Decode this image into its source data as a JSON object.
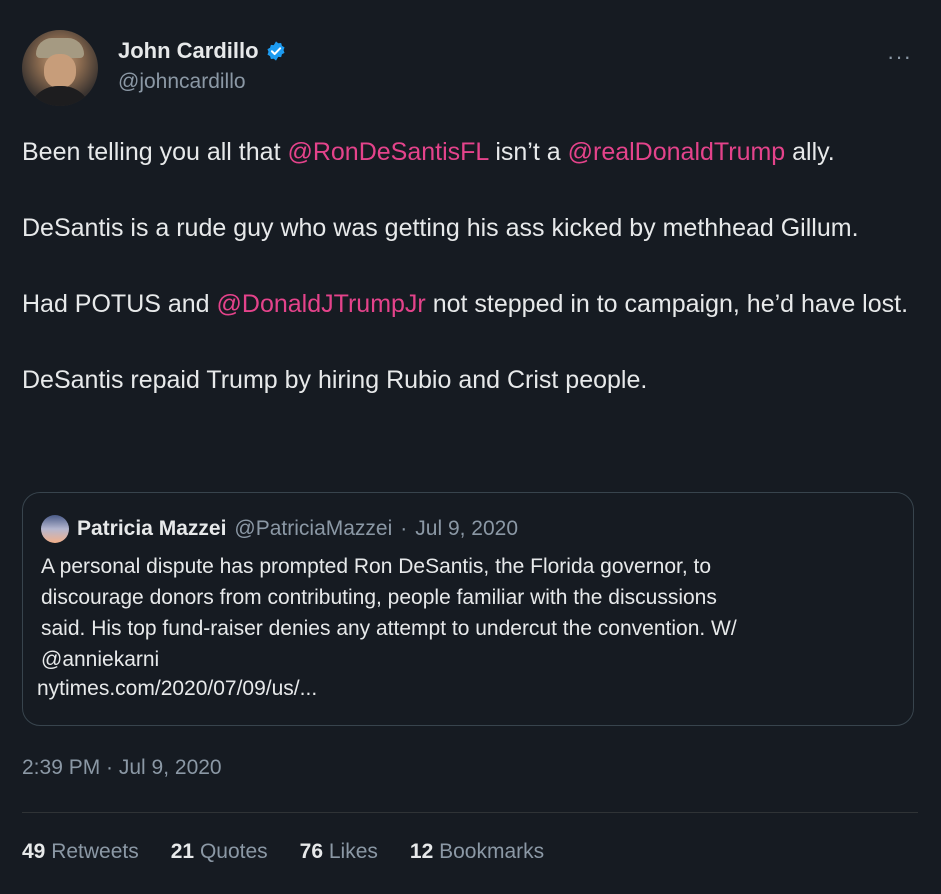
{
  "author": {
    "display_name": "John Cardillo",
    "handle": "@johncardillo",
    "verified_icon": "verified-badge-icon",
    "verified_color": "#1d9bf0"
  },
  "more_menu": "···",
  "tweet": {
    "paragraphs": [
      {
        "segments": [
          {
            "text": "Been telling you all that ",
            "mention": false
          },
          {
            "text": "@RonDeSantisFL",
            "mention": true
          },
          {
            "text": " isn’t a ",
            "mention": false
          },
          {
            "text": "@realDonaldTrump",
            "mention": true
          },
          {
            "text": " ally.",
            "mention": false
          }
        ]
      },
      {
        "segments": [
          {
            "text": "DeSantis is a rude guy who was getting his ass kicked by methhead Gillum.",
            "mention": false
          }
        ]
      },
      {
        "segments": [
          {
            "text": "Had POTUS and ",
            "mention": false
          },
          {
            "text": "@DonaldJTrumpJr",
            "mention": true
          },
          {
            "text": " not stepped in to campaign, he’d have lost.",
            "mention": false
          }
        ]
      },
      {
        "segments": [
          {
            "text": "DeSantis repaid Trump by hiring Rubio and Crist people.",
            "mention": false
          }
        ]
      }
    ],
    "mention_color": "#e4438b"
  },
  "quote": {
    "name": "Patricia Mazzei",
    "handle": "@PatriciaMazzei",
    "separator": "·",
    "date": "Jul 9, 2020",
    "text_lines": [
      "A personal dispute has prompted Ron DeSantis, the Florida governor, to",
      "discourage donors from contributing, people familiar with the discussions",
      "said. His top fund-raiser denies any attempt to undercut the convention. W/",
      "@anniekarni"
    ],
    "link": "nytimes.com/2020/07/09/us/..."
  },
  "timestamp": "2:39 PM · Jul 9, 2020",
  "stats": [
    {
      "count": "49",
      "label": "Retweets"
    },
    {
      "count": "21",
      "label": "Quotes"
    },
    {
      "count": "76",
      "label": "Likes"
    },
    {
      "count": "12",
      "label": "Bookmarks"
    }
  ]
}
